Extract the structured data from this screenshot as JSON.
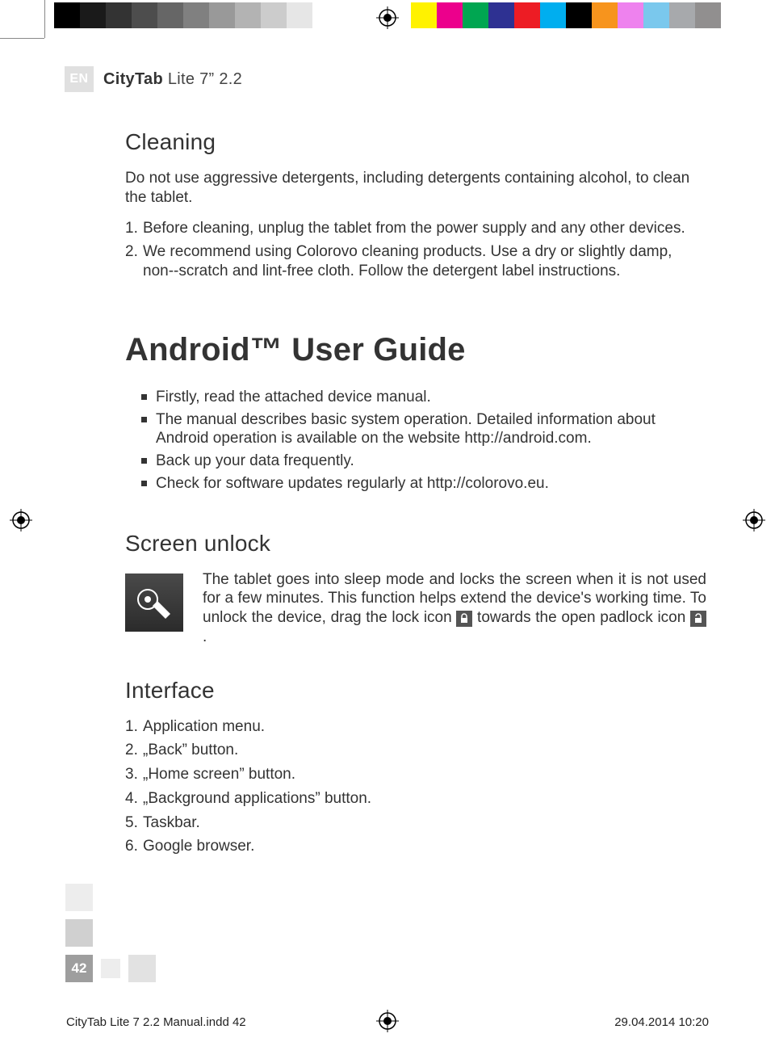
{
  "print": {
    "grayscale_swatches": [
      "#000000",
      "#1a1a1a",
      "#333333",
      "#4d4d4d",
      "#666666",
      "#808080",
      "#999999",
      "#b3b3b3",
      "#cccccc",
      "#e6e6e6",
      "#ffffff"
    ],
    "color_swatches": [
      "#fff200",
      "#ec008c",
      "#00a651",
      "#2e3192",
      "#ed1c24",
      "#00aeef",
      "#000000",
      "#f7941d",
      "#ee82ee",
      "#7ac8ed",
      "#a7a9ac",
      "#918f8f"
    ]
  },
  "header": {
    "lang_badge": "EN",
    "product_bold": "CityTab",
    "product_light": " Lite 7” 2.2"
  },
  "cleaning": {
    "heading": "Cleaning",
    "intro": "Do not use aggressive detergents, including detergents containing alcohol, to clean the tablet.",
    "steps": [
      "Before cleaning, unplug the tablet from the power supply and any other devices.",
      "We recommend using Colorovo cleaning products. Use a dry or slightly damp, non--scratch and lint-free cloth. Follow the detergent label instructions."
    ]
  },
  "android": {
    "heading": "Android™ User Guide",
    "bullets": [
      "Firstly, read the attached device manual.",
      "The manual describes basic system operation. Detailed information about Android operation is available on the website http://android.com.",
      "Back up your data frequently.",
      "Check for software updates regularly at http://colorovo.eu."
    ]
  },
  "screen_unlock": {
    "heading": "Screen unlock",
    "t1": "The tablet goes into sleep mode and locks the screen when it is not used for a few minutes. This function helps extend the device's working time. To unlock the device, drag the lock icon ",
    "t2": " towards the open padlock icon ",
    "t3": " ."
  },
  "interface": {
    "heading": "Interface",
    "items": [
      "Application menu.",
      "„Back” button.",
      "„Home screen” button.",
      "„Background applications” button.",
      "Taskbar.",
      "Google browser."
    ]
  },
  "page_number": "42",
  "slug": {
    "file": "CityTab Lite 7 2.2 Manual.indd   42",
    "datetime": "29.04.2014   10:20"
  }
}
